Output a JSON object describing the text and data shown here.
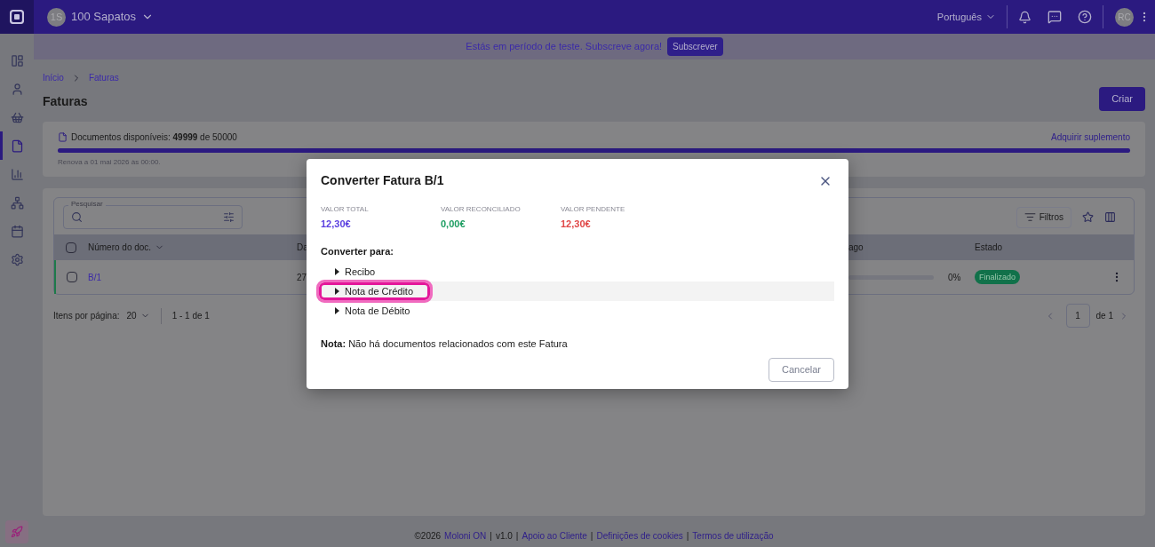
{
  "header": {
    "company_initials": "1S",
    "company": "100 Sapatos",
    "language": "Português",
    "user_initials": "RC"
  },
  "sidebar": {
    "items": [
      {
        "selected": false
      },
      {
        "selected": false
      },
      {
        "selected": false
      },
      {
        "selected": true
      },
      {
        "selected": false
      },
      {
        "selected": false
      },
      {
        "selected": false
      },
      {
        "selected": false
      }
    ]
  },
  "banner": {
    "text": "Estás em período de teste. Subscreve agora!",
    "button": "Subscrever"
  },
  "breadcrumb": [
    "Início",
    "Faturas"
  ],
  "title": "Faturas",
  "create_button": "Criar",
  "quota": {
    "text": "Documentos disponíveis: **49999** de 50000",
    "level": 1,
    "link": "Adquirir suplemento",
    "renew": "Renova a 01 mai 2026 às 00:00."
  },
  "table": {
    "search_label": "Pesquisar",
    "filters": "Filtros",
    "header_checked": false,
    "columns": [
      "Número do doc.",
      "Da",
      "ago",
      "Estado"
    ],
    "rows": [
      {
        "checked": false,
        "doc": "B/1",
        "date": "27",
        "level": 0,
        "percent": "0%",
        "status": "Finalizado"
      }
    ]
  },
  "pagination": {
    "per_page_label": "Itens por página:",
    "per_page": "20",
    "range": "1 - 1 de 1",
    "page": "1",
    "of": "de 1"
  },
  "modal": {
    "title": "Converter Fatura B/1",
    "summary": [
      {
        "label": "VALOR TOTAL",
        "value": "12,30€",
        "color": "#5b3fe0"
      },
      {
        "label": "VALOR RECONCILIADO",
        "value": "0,00€",
        "color": "#1e9e62"
      },
      {
        "label": "VALOR PENDENTE",
        "value": "12,30€",
        "color": "#e04848"
      }
    ],
    "convert_label": "Converter para:",
    "options": [
      {
        "label": "Recibo",
        "selected": false
      },
      {
        "label": "Nota de Crédito",
        "selected": true
      },
      {
        "label": "Nota de Débito",
        "selected": false
      }
    ],
    "note": "**Nota:** Não há documentos relacionados com este Fatura",
    "cancel": "Cancelar"
  },
  "footer": [
    {
      "kind": "text",
      "text": "©2026"
    },
    {
      "kind": "link",
      "text": "Moloni ON"
    },
    {
      "kind": "separator",
      "text": "|"
    },
    {
      "kind": "text",
      "text": "v1.0"
    },
    {
      "kind": "separator",
      "text": "|"
    },
    {
      "kind": "link",
      "text": "Apoio ao Cliente"
    },
    {
      "kind": "separator",
      "text": "|"
    },
    {
      "kind": "link",
      "text": "Definições de cookies"
    },
    {
      "kind": "separator",
      "text": "|"
    },
    {
      "kind": "link",
      "text": "Termos de utilização"
    }
  ]
}
